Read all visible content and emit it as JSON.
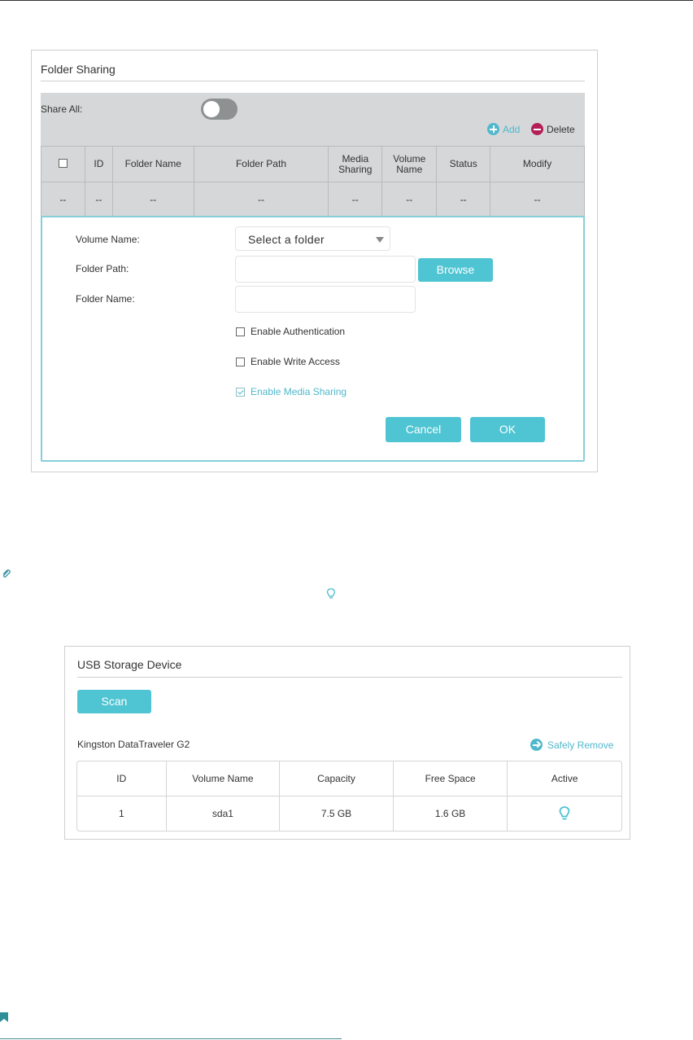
{
  "folder_sharing": {
    "title": "Folder Sharing",
    "share_all_label": "Share All:",
    "share_all_enabled": false,
    "add_label": "Add",
    "delete_label": "Delete",
    "columns": [
      "ID",
      "Folder Name",
      "Folder Path",
      "Media Sharing",
      "Volume Name",
      "Status",
      "Modify"
    ],
    "empty_row": [
      "--",
      "--",
      "--",
      "--",
      "--",
      "--",
      "--",
      "--"
    ],
    "form": {
      "volume_name_label": "Volume Name:",
      "volume_select_value": "Select a folder",
      "folder_path_label": "Folder Path:",
      "folder_path_value": "",
      "browse_label": "Browse",
      "folder_name_label": "Folder Name:",
      "folder_name_value": "",
      "enable_authentication_label": "Enable Authentication",
      "enable_authentication_checked": false,
      "enable_write_access_label": "Enable Write Access",
      "enable_write_access_checked": false,
      "enable_media_sharing_label": "Enable Media Sharing",
      "enable_media_sharing_checked": true,
      "cancel_label": "Cancel",
      "ok_label": "OK"
    }
  },
  "usb_storage": {
    "title": "USB Storage Device",
    "scan_label": "Scan",
    "device_name": "Kingston  DataTraveler G2",
    "safely_remove_label": "Safely Remove",
    "columns": [
      "ID",
      "Volume Name",
      "Capacity",
      "Free Space",
      "Active"
    ],
    "rows": [
      {
        "id": "1",
        "volume_name": "sda1",
        "capacity": "7.5 GB",
        "free_space": "1.6 GB",
        "active_icon": "bulb-icon"
      }
    ]
  },
  "colors": {
    "accent": "#4fc4d2",
    "delete": "#b41f57",
    "grey_zone": "#d5d7d8"
  },
  "icons": [
    "paperclip-icon",
    "lightbulb-icon",
    "bookmark-icon",
    "add-icon",
    "delete-icon",
    "arrow-right-icon"
  ]
}
